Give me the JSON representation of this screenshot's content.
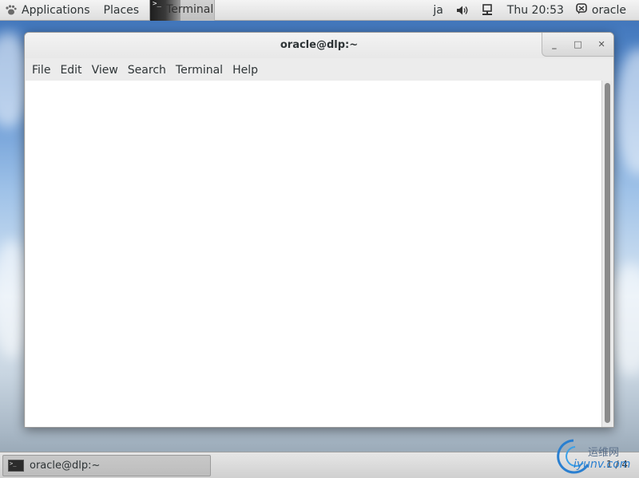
{
  "top_panel": {
    "applications_label": "Applications",
    "places_label": "Places",
    "terminal_launcher_label": "Terminal",
    "language": "ja",
    "clock": "Thu 20:53",
    "user_name": "oracle"
  },
  "window": {
    "title": "oracle@dlp:~",
    "controls": {
      "minimize": "_",
      "maximize": "□",
      "close": "✕"
    },
    "menu": [
      "File",
      "Edit",
      "View",
      "Search",
      "Terminal",
      "Help"
    ]
  },
  "bottom_panel": {
    "taskbar_label": "oracle@dlp:~",
    "workspace": "1 / 4"
  },
  "watermark": {
    "chinese": "运维网",
    "latin": "iyunv.com"
  },
  "colors": {
    "panel_bg": "#dedede",
    "window_bg": "#ececec",
    "terminal_bg": "#ffffff",
    "scroll_thumb": "#8a8a8a"
  }
}
